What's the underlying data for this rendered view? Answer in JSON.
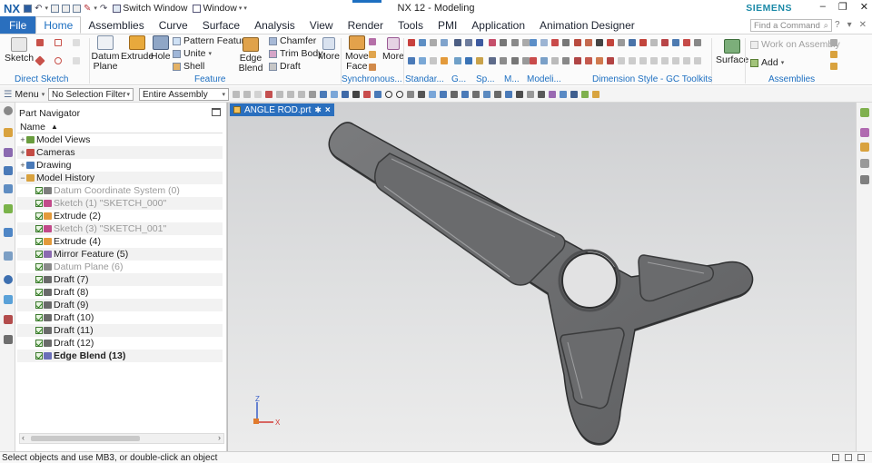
{
  "window": {
    "logo": "NX",
    "title": "NX 12 - Modeling",
    "brand": "SIEMENS",
    "switch_window": "Switch Window",
    "window_menu": "Window"
  },
  "tabs": [
    "File",
    "Home",
    "Assemblies",
    "Curve",
    "Surface",
    "Analysis",
    "View",
    "Render",
    "Tools",
    "PMI",
    "Application",
    "Animation Designer"
  ],
  "active_tab": "Home",
  "search_command": {
    "placeholder": "Find a Command"
  },
  "ribbon": {
    "direct_sketch": {
      "sketch": "Sketch",
      "group": "Direct Sketch"
    },
    "feature": {
      "datum_plane": "Datum\nPlane",
      "extrude": "Extrude",
      "hole": "Hole",
      "pattern_feature": "Pattern Feature",
      "unite": "Unite",
      "shell": "Shell",
      "edge_blend": "Edge\nBlend",
      "chamfer": "Chamfer",
      "trim_body": "Trim Body",
      "draft": "Draft",
      "more": "More",
      "group": "Feature"
    },
    "synchronous": {
      "move_face": "Move\nFace",
      "more": "More",
      "group": "Synchronous..."
    },
    "standard_group": "Standar...",
    "g_group": "G...",
    "sp_group": "Sp...",
    "m_group": "M...",
    "modeling_group": "Modeli...",
    "dimension_style_group": "Dimension Style - GC Toolkits",
    "surface": {
      "label": "Surface",
      "group": ""
    },
    "assemblies": {
      "work_on_assembly": "Work on Assembly",
      "add": "Add",
      "group": "Assemblies"
    }
  },
  "toolbar": {
    "menu": "Menu",
    "selection_filter": "No Selection Filter",
    "scope": "Entire Assembly"
  },
  "navigator": {
    "title": "Part Navigator",
    "column": "Name",
    "items": [
      {
        "label": "Model Views",
        "state": "normal"
      },
      {
        "label": "Cameras",
        "state": "normal"
      },
      {
        "label": "Drawing",
        "state": "normal"
      },
      {
        "label": "Model History",
        "state": "normal"
      },
      {
        "label": "Datum Coordinate System (0)",
        "state": "dim"
      },
      {
        "label": "Sketch (1) \"SKETCH_000\"",
        "state": "dim"
      },
      {
        "label": "Extrude (2)",
        "state": "normal"
      },
      {
        "label": "Sketch (3) \"SKETCH_001\"",
        "state": "dim"
      },
      {
        "label": "Extrude (4)",
        "state": "normal"
      },
      {
        "label": "Mirror Feature (5)",
        "state": "normal"
      },
      {
        "label": "Datum Plane (6)",
        "state": "dim"
      },
      {
        "label": "Draft (7)",
        "state": "normal"
      },
      {
        "label": "Draft (8)",
        "state": "normal"
      },
      {
        "label": "Draft (9)",
        "state": "normal"
      },
      {
        "label": "Draft (10)",
        "state": "normal"
      },
      {
        "label": "Draft (11)",
        "state": "normal"
      },
      {
        "label": "Draft (12)",
        "state": "normal"
      },
      {
        "label": "Edge Blend (13)",
        "state": "bold"
      }
    ]
  },
  "viewport": {
    "doc_tab": "ANGLE ROD.prt",
    "doc_tab_modified": "✱",
    "triad": {
      "x": "X",
      "y": "Y",
      "z": "Z"
    }
  },
  "status": "Select objects and use MB3, or double-click an object",
  "colors": {
    "accent": "#2a6fbe",
    "brand": "#1c8aa8",
    "part": "#6d6e70"
  }
}
